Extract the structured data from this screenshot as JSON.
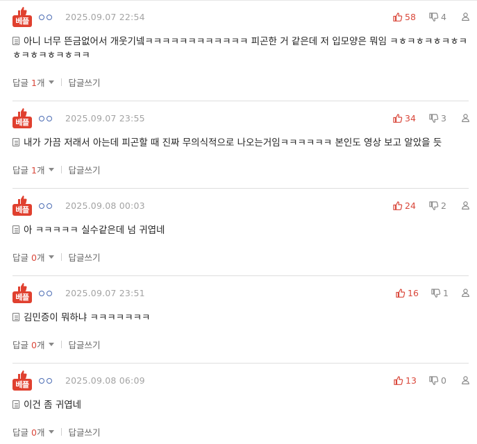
{
  "comments": [
    {
      "badge": "베플",
      "date": "2025.09.07 22:54",
      "likes": "58",
      "dislikes": "4",
      "text": "아니 너무 뜬금없어서 개웃기넼ㅋㅋㅋㅋㅋㅋㅋㅋㅋㅋㅋㅋ 피곤한 거 같은데 저 입모양은 뭐임 ㅋㅎㅋㅎㅋㅎㅋㅎㅋㅎㅋㅎㅋㅎㅋㅎㅋㅋ",
      "reply_prefix": "답글 ",
      "reply_count": "1",
      "reply_suffix": "개",
      "write_reply": "답글쓰기"
    },
    {
      "badge": "베플",
      "date": "2025.09.07 23:55",
      "likes": "34",
      "dislikes": "3",
      "text": "내가 가끔 저래서 아는데 피곤할 때 진짜 무의식적으로 나오는거임ㅋㅋㅋㅋㅋㅋ 본인도 영상 보고 알았을 듯",
      "reply_prefix": "답글 ",
      "reply_count": "1",
      "reply_suffix": "개",
      "write_reply": "답글쓰기"
    },
    {
      "badge": "베플",
      "date": "2025.09.08 00:03",
      "likes": "24",
      "dislikes": "2",
      "text": "아 ㅋㅋㅋㅋㅋ 실수같은데 넘 귀엽네",
      "reply_prefix": "답글 ",
      "reply_count": "0",
      "reply_suffix": "개",
      "write_reply": "답글쓰기"
    },
    {
      "badge": "베플",
      "date": "2025.09.07 23:51",
      "likes": "16",
      "dislikes": "1",
      "text": "김민증이 뭐하냐 ㅋㅋㅋㅋㅋㅋㅋ",
      "reply_prefix": "답글 ",
      "reply_count": "0",
      "reply_suffix": "개",
      "write_reply": "답글쓰기"
    },
    {
      "badge": "베플",
      "date": "2025.09.08 06:09",
      "likes": "13",
      "dislikes": "0",
      "text": "이건 좀 귀엽네",
      "reply_prefix": "답글 ",
      "reply_count": "0",
      "reply_suffix": "개",
      "write_reply": "답글쓰기"
    }
  ],
  "colors": {
    "accent": "#e0402f",
    "like": "#d9473a",
    "meta": "#a3a3a3",
    "dots": "#4a6bb3"
  }
}
